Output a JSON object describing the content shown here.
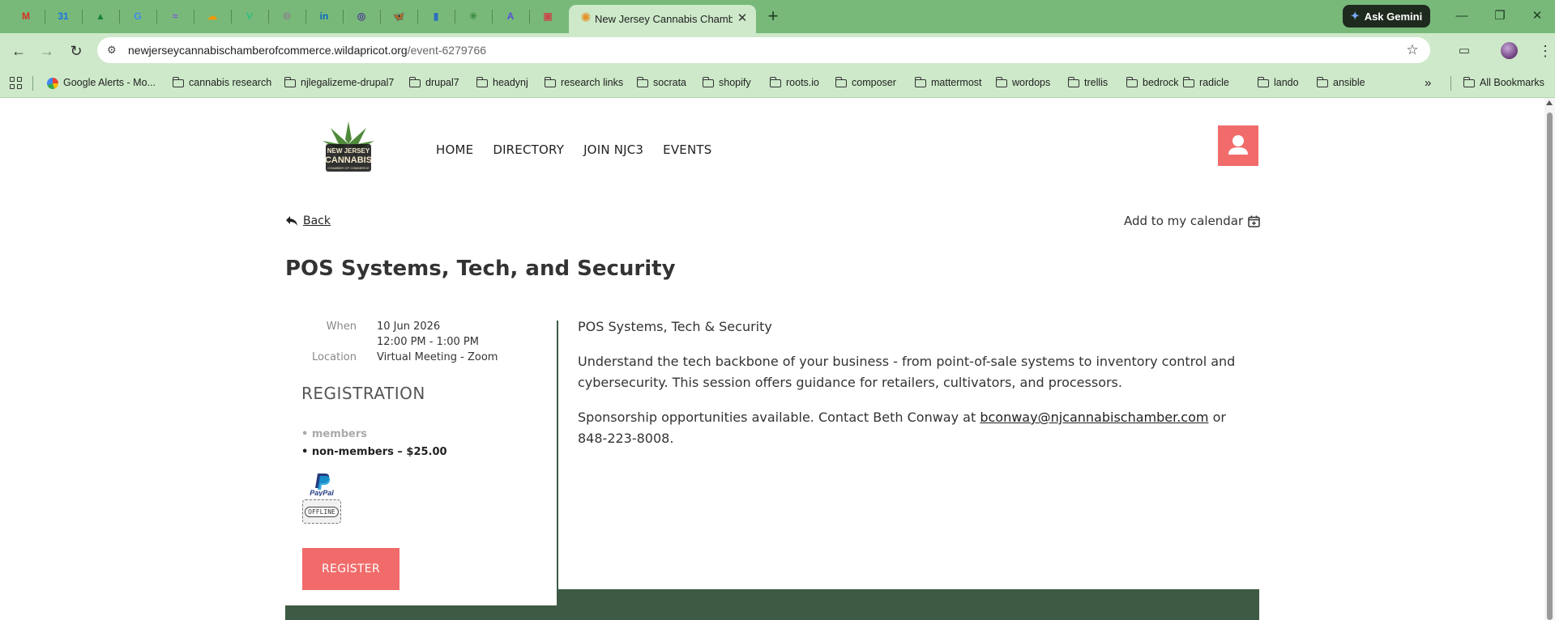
{
  "browser": {
    "active_tab_title": "New Jersey Cannabis Chamber",
    "ask_gemini_label": "Ask Gemini",
    "url_host": "newjerseycannabischamberofcommerce.wildapricot.org",
    "url_path": "/event-6279766",
    "pinned_tabs": [
      {
        "icon": "gmail-icon",
        "glyph": "M",
        "color": "#d93025"
      },
      {
        "icon": "calendar-icon",
        "glyph": "31",
        "color": "#1a73e8"
      },
      {
        "icon": "drive-icon",
        "glyph": "▲",
        "color": "#188038"
      },
      {
        "icon": "google-icon",
        "glyph": "G",
        "color": "#4285f4"
      },
      {
        "icon": "sheets-icon",
        "glyph": "≈",
        "color": "#7b5cd6"
      },
      {
        "icon": "cloud-icon",
        "glyph": "☁",
        "color": "#f29900"
      },
      {
        "icon": "vuejs-icon",
        "glyph": "V",
        "color": "#2fbf7f"
      },
      {
        "icon": "settings-icon",
        "glyph": "⚙",
        "color": "#8a8a8a"
      },
      {
        "icon": "linkedin-icon",
        "glyph": "in",
        "color": "#0a66c2"
      },
      {
        "icon": "mastodon-icon",
        "glyph": "◎",
        "color": "#4f3b96"
      },
      {
        "icon": "bluesky-icon",
        "glyph": "🦋",
        "color": "#1185fe"
      },
      {
        "icon": "phone-icon",
        "glyph": "▮",
        "color": "#2c6fc0"
      },
      {
        "icon": "sprout-icon",
        "glyph": "✳",
        "color": "#3c8a3c"
      },
      {
        "icon": "app-a-icon",
        "glyph": "A",
        "color": "#5b4fd6"
      },
      {
        "icon": "image-icon",
        "glyph": "▣",
        "color": "#c94a4a"
      }
    ],
    "bookmarks": [
      {
        "label": "Google Alerts - Mo...",
        "type": "google"
      },
      {
        "label": "cannabis research",
        "type": "folder"
      },
      {
        "label": "njlegalizeme-drupal7",
        "type": "folder"
      },
      {
        "label": "drupal7",
        "type": "folder"
      },
      {
        "label": "headynj",
        "type": "folder"
      },
      {
        "label": "research links",
        "type": "folder"
      },
      {
        "label": "socrata",
        "type": "folder"
      },
      {
        "label": "shopify",
        "type": "folder"
      },
      {
        "label": "roots.io",
        "type": "folder"
      },
      {
        "label": "composer",
        "type": "folder"
      },
      {
        "label": "mattermost",
        "type": "folder"
      },
      {
        "label": "wordops",
        "type": "folder"
      },
      {
        "label": "trellis",
        "type": "folder"
      },
      {
        "label": "bedrock",
        "type": "folder"
      },
      {
        "label": "radicle",
        "type": "folder"
      },
      {
        "label": "lando",
        "type": "folder"
      },
      {
        "label": "ansible",
        "type": "folder"
      }
    ],
    "all_bookmarks_label": "All Bookmarks",
    "overflow_label": "»"
  },
  "site": {
    "nav": [
      "HOME",
      "DIRECTORY",
      "JOIN NJC3",
      "EVENTS"
    ],
    "logo_text": [
      "NEW JERSEY",
      "CANNABIS",
      "CHAMBER OF COMMERCE"
    ],
    "accent_color": "#f16b6b",
    "dark_green": "#3d5a44"
  },
  "event": {
    "back_label": "Back",
    "add_calendar_label": "Add to my calendar",
    "title": "POS Systems, Tech, and Security",
    "when_label": "When",
    "date": "10 Jun 2026",
    "time": "12:00 PM - 1:00 PM",
    "location_label": "Location",
    "location": "Virtual Meeting - Zoom",
    "registration_title": "REGISTRATION",
    "registration_types": [
      {
        "label": "members",
        "available": false
      },
      {
        "label": "non-members – $25.00",
        "available": true
      }
    ],
    "paypal_label": "PayPal",
    "offline_label": "OFFLINE",
    "register_button": "REGISTER",
    "description": {
      "heading": "POS Systems, Tech & Security",
      "body": "Understand the tech backbone of your business - from point-of-sale systems to inventory control and cybersecurity. This session offers guidance for retailers, cultivators, and processors.",
      "sponsor_prefix": "Sponsorship opportunities available. Contact Beth Conway at ",
      "sponsor_email": "bconway@njcannabischamber.com",
      "sponsor_suffix": " or 848-223-8008."
    }
  }
}
